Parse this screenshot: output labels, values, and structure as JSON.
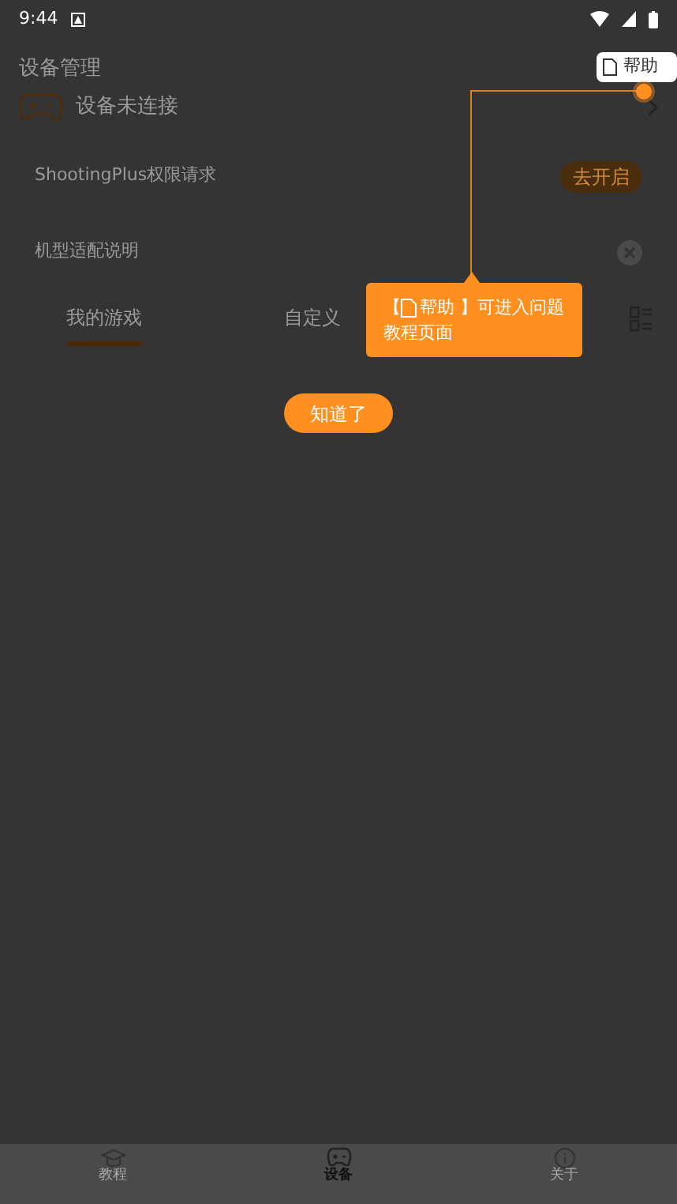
{
  "status_bar": {
    "time": "9:44"
  },
  "header": {
    "title": "设备管理"
  },
  "device": {
    "status": "设备未连接"
  },
  "notices": [
    {
      "kind": "action",
      "text": "ShootingPlus权限请求",
      "action": "去开启"
    },
    {
      "kind": "dismiss",
      "text": "机型适配说明"
    }
  ],
  "tabs": [
    {
      "label": "我的游戏",
      "selected": true
    },
    {
      "label": "自定义",
      "selected": false
    }
  ],
  "coach": {
    "help_label": "帮助",
    "tooltip_prefix": "【",
    "tooltip_text": "帮助 】可进入问题",
    "tooltip_text_2": "教程页面",
    "confirm": "知道了"
  },
  "bottom_nav": [
    {
      "label": "教程",
      "kind": "cap",
      "selected": false
    },
    {
      "label": "设备",
      "kind": "gamepad",
      "selected": true
    },
    {
      "label": "关于",
      "kind": "info",
      "selected": false
    }
  ]
}
